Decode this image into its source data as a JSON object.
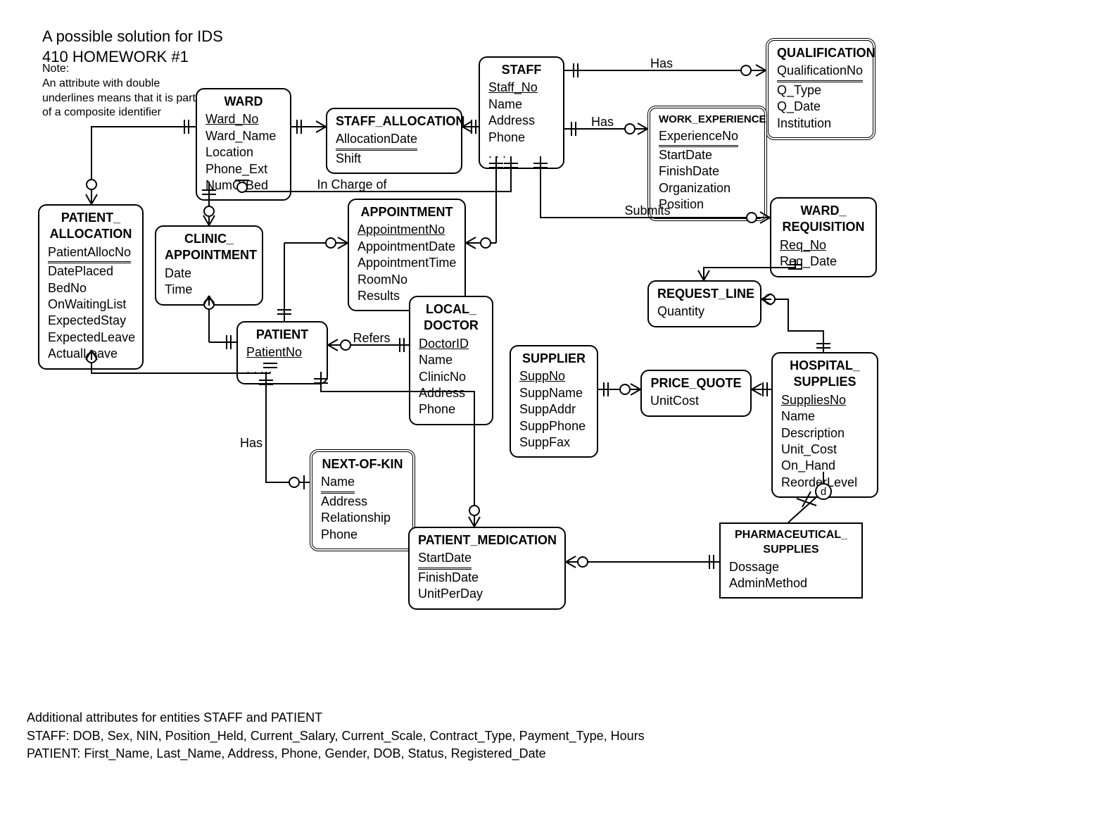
{
  "title": "A possible solution for IDS\n410 HOMEWORK #1",
  "note_label": "Note:",
  "note_text": "An attribute with double underlines  means that it is part of a composite identifier",
  "footer_title": "Additional attributes for entities STAFF and PATIENT",
  "footer_staff": "STAFF: DOB, Sex, NIN, Position_Held, Current_Salary, Current_Scale, Contract_Type, Payment_Type, Hours",
  "footer_patient": "PATIENT: First_Name, Last_Name, Address, Phone, Gender, DOB, Status, Registered_Date",
  "rel_has1": "Has",
  "rel_has2": "Has",
  "rel_has3": "Has",
  "rel_incharge": "In Charge of",
  "rel_submits": "Submits",
  "rel_refers": "Refers",
  "ward": {
    "name": "WARD",
    "pk": "Ward_No",
    "a1": "Ward_Name",
    "a2": "Location",
    "a3": "Phone_Ext",
    "a4": "NumOfBed"
  },
  "staff_allocation": {
    "name": "STAFF_ALLOCATION",
    "pk": "AllocationDate",
    "a1": "Shift"
  },
  "staff": {
    "name": "STAFF",
    "pk": "Staff_No",
    "a1": "Name",
    "a2": "Address",
    "a3": "Phone",
    "a4": ". . ."
  },
  "qualification": {
    "name": "QUALIFICATION",
    "pk": "QualificationNo",
    "a1": "Q_Type",
    "a2": "Q_Date",
    "a3": "Institution"
  },
  "work_exp": {
    "name": "WORK_EXPERIENCE",
    "pk": "ExperienceNo",
    "a1": "StartDate",
    "a2": "FinishDate",
    "a3": "Organization",
    "a4": "Position"
  },
  "patient_alloc": {
    "name1": "PATIENT_",
    "name2": "ALLOCATION",
    "pk": "PatientAllocNo",
    "a1": "DatePlaced",
    "a2": "BedNo",
    "a3": "OnWaitingList",
    "a4": "ExpectedStay",
    "a5": "ExpectedLeave",
    "a6": "ActualLeave"
  },
  "clinic_appt": {
    "name1": "CLINIC_",
    "name2": "APPOINTMENT",
    "a1": "Date",
    "a2": "Time"
  },
  "appointment": {
    "name": "APPOINTMENT",
    "pk": "AppointmentNo",
    "a1": "AppointmentDate",
    "a2": "AppointmentTime",
    "a3": "RoomNo",
    "a4": "Results"
  },
  "ward_req": {
    "name1": "WARD_",
    "name2": "REQUISITION",
    "pk": "Req_No",
    "a1": "Req_Date"
  },
  "request_line": {
    "name": "REQUEST_LINE",
    "a1": "Quantity"
  },
  "patient": {
    "name": "PATIENT",
    "pk": "PatientNo",
    "a1": ". . ."
  },
  "local_doctor": {
    "name1": "LOCAL_",
    "name2": "DOCTOR",
    "pk": "DoctorID",
    "a1": "Name",
    "a2": "ClinicNo",
    "a3": "Address",
    "a4": "Phone"
  },
  "supplier": {
    "name": "SUPPLIER",
    "pk": "SuppNo",
    "a1": "SuppName",
    "a2": "SuppAddr",
    "a3": "SuppPhone",
    "a4": "SuppFax"
  },
  "price_quote": {
    "name": "PRICE_QUOTE",
    "a1": "UnitCost"
  },
  "hospital_supplies": {
    "name1": "HOSPITAL_",
    "name2": "SUPPLIES",
    "pk": "SuppliesNo",
    "a1": "Name",
    "a2": "Description",
    "a3": "Unit_Cost",
    "a4": "On_Hand",
    "a5": "ReorderLevel"
  },
  "next_of_kin": {
    "name": "NEXT-OF-KIN",
    "pk": "Name",
    "a1": "Address",
    "a2": "Relationship",
    "a3": "Phone"
  },
  "patient_med": {
    "name": "PATIENT_MEDICATION",
    "pk": "StartDate",
    "a1": "FinishDate",
    "a2": "UnitPerDay"
  },
  "pharm_supplies": {
    "name1": "PHARMACEUTICAL_",
    "name2": "SUPPLIES",
    "a1": "Dossage",
    "a2": "AdminMethod"
  },
  "d_label": "d"
}
